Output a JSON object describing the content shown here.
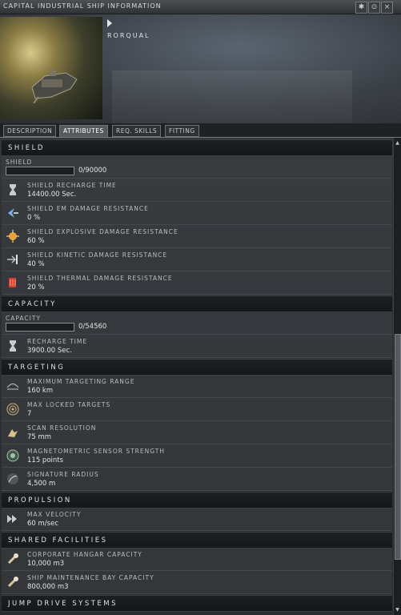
{
  "window": {
    "title": "CAPITAL INDUSTRIAL SHIP INFORMATION",
    "controls": [
      "✱",
      "⊙",
      "×"
    ]
  },
  "ship": {
    "name": "RORQUAL"
  },
  "tabs": [
    {
      "label": "DESCRIPTION",
      "active": false
    },
    {
      "label": "ATTRIBUTES",
      "active": true
    },
    {
      "label": "REQ. SKILLS",
      "active": false
    },
    {
      "label": "FITTING",
      "active": false
    }
  ],
  "sections": {
    "shield": {
      "title": "SHIELD",
      "bar": {
        "label": "SHIELD",
        "value": "0/90000",
        "fraction": 0
      },
      "rows": [
        {
          "label": "SHIELD RECHARGE TIME",
          "value": "14400.00 Sec.",
          "icon": "hourglass-icon"
        },
        {
          "label": "SHIELD EM DAMAGE RESISTANCE",
          "value": "0 %",
          "icon": "em-resist-icon"
        },
        {
          "label": "SHIELD EXPLOSIVE DAMAGE RESISTANCE",
          "value": "60 %",
          "icon": "explosive-resist-icon"
        },
        {
          "label": "SHIELD KINETIC DAMAGE RESISTANCE",
          "value": "40 %",
          "icon": "kinetic-resist-icon"
        },
        {
          "label": "SHIELD THERMAL DAMAGE RESISTANCE",
          "value": "20 %",
          "icon": "thermal-resist-icon"
        }
      ]
    },
    "capacity": {
      "title": "CAPACITY",
      "bar": {
        "label": "CAPACITY",
        "value": "0/54560",
        "fraction": 0
      },
      "rows": [
        {
          "label": "RECHARGE TIME",
          "value": "3900.00 Sec.",
          "icon": "hourglass-icon"
        }
      ]
    },
    "targeting": {
      "title": "TARGETING",
      "rows": [
        {
          "label": "MAXIMUM TARGETING RANGE",
          "value": "160 km",
          "icon": "range-icon"
        },
        {
          "label": "MAX LOCKED TARGETS",
          "value": "7",
          "icon": "target-icon"
        },
        {
          "label": "SCAN RESOLUTION",
          "value": "75 mm",
          "icon": "scan-icon"
        },
        {
          "label": "MAGNETOMETRIC SENSOR STRENGTH",
          "value": "115 points",
          "icon": "sensor-icon"
        },
        {
          "label": "SIGNATURE RADIUS",
          "value": "4,500 m",
          "icon": "signature-icon"
        }
      ]
    },
    "propulsion": {
      "title": "PROPULSION",
      "rows": [
        {
          "label": "MAX VELOCITY",
          "value": "60 m/sec",
          "icon": "velocity-icon"
        }
      ]
    },
    "shared": {
      "title": "SHARED FACILITIES",
      "rows": [
        {
          "label": "CORPORATE HANGAR CAPACITY",
          "value": "10,000 m3",
          "icon": "hangar-icon"
        },
        {
          "label": "SHIP MAINTENANCE BAY CAPACITY",
          "value": "800,000 m3",
          "icon": "maintenance-bay-icon"
        }
      ]
    },
    "jump": {
      "title": "JUMP DRIVE SYSTEMS"
    }
  },
  "colors": {
    "em": "#7fb6e8",
    "explosive": "#e8a040",
    "kinetic": "#c0c4c8",
    "thermal": "#d04030"
  }
}
